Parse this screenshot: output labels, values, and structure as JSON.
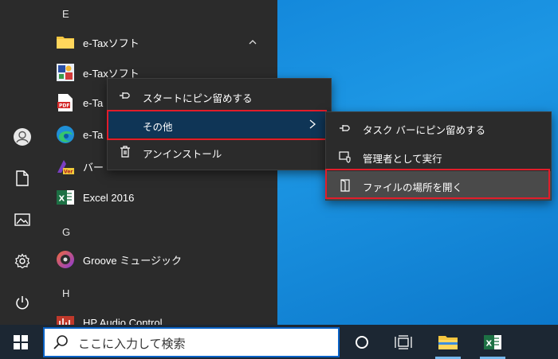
{
  "start_menu": {
    "letters": {
      "e": "E",
      "g": "G",
      "h": "H"
    },
    "apps": {
      "etax_folder": "e-Taxソフト",
      "etax_app": "e-Taxソフト",
      "pdf_app": "e-Ta",
      "edge_app": "e-Ta",
      "ver_app": "バー",
      "excel": "Excel 2016",
      "groove": "Groove ミュージック",
      "hp_audio": "HP Audio Control"
    }
  },
  "context_menu": {
    "pin_start": "スタートにピン留めする",
    "more": "その他",
    "uninstall": "アンインストール"
  },
  "submenu": {
    "pin_taskbar": "タスク バーにピン留めする",
    "run_admin": "管理者として実行",
    "open_location": "ファイルの場所を開く"
  },
  "taskbar": {
    "search_placeholder": "ここに入力して検索"
  },
  "colors": {
    "highlight_border": "#e11d2a",
    "selected_item": "#0f3556",
    "hover_item": "#4a4a4a",
    "menu_bg": "#2b2b2b"
  }
}
